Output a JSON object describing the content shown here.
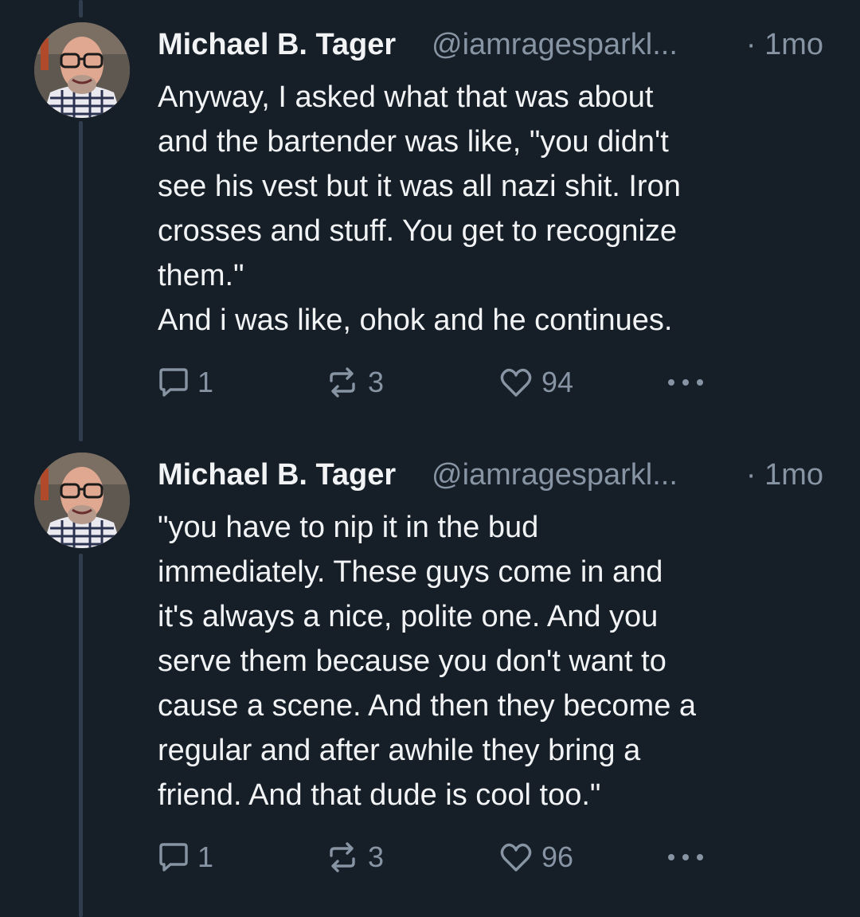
{
  "posts": [
    {
      "author": "Michael B. Tager",
      "handle": "@iamragesparkl...",
      "time": "· 1mo",
      "lines": [
        "Anyway, I asked what that was about",
        "and the bartender was like, \"you didn't",
        "see his vest but it was all nazi shit. Iron",
        "crosses and stuff. You get to recognize",
        "them.\"",
        "And i was like, ohok and he continues."
      ],
      "replies": "1",
      "reposts": "3",
      "likes": "94",
      "icons": [
        "reply-icon",
        "repost-icon",
        "heart-icon",
        "more-icon"
      ]
    },
    {
      "author": "Michael B. Tager",
      "handle": "@iamragesparkl...",
      "time": "· 1mo",
      "lines": [
        "\"you have to nip it in the bud",
        "immediately. These guys come in and",
        "it's always a nice, polite one. And you",
        "serve them because you don't want to",
        "cause a scene. And then they become a",
        "regular and after awhile they bring a",
        "friend. And that dude is cool too.\""
      ],
      "replies": "1",
      "reposts": "3",
      "likes": "96",
      "icons": [
        "reply-icon",
        "repost-icon",
        "heart-icon",
        "more-icon"
      ]
    }
  ],
  "colors": {
    "background": "#161e27",
    "text": "#f1f3f5",
    "muted": "#8794a3",
    "thread_line": "#2f3d4c"
  }
}
